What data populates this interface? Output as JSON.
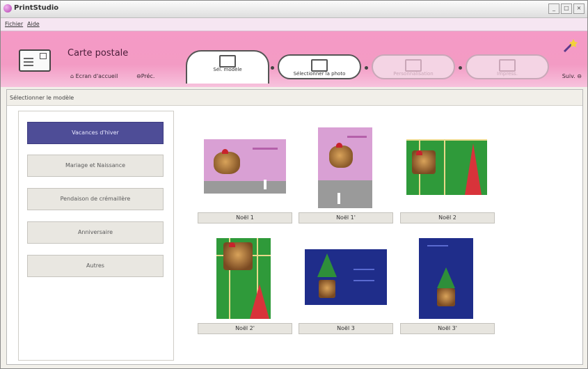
{
  "window": {
    "title": "PrintStudio",
    "controls": [
      "_",
      "□",
      "×"
    ]
  },
  "menu": {
    "items": [
      "Fichier",
      "Aide"
    ]
  },
  "header": {
    "title": "Carte postale",
    "home_label": "Ecran d'accueil",
    "prev_label": "Préc.",
    "next_label": "Suiv.",
    "steps": [
      {
        "label": "Sél. modèle",
        "state": "active",
        "icon": "template-icon"
      },
      {
        "label": "Sélectionner la photo",
        "state": "enabled",
        "icon": "photo-icon"
      },
      {
        "label": "Personnalisation",
        "state": "disabled",
        "icon": "customize-icon"
      },
      {
        "label": "Impress.",
        "state": "disabled",
        "icon": "printer-icon"
      }
    ]
  },
  "content": {
    "header_label": "Sélectionner le modèle",
    "categories": [
      {
        "label": "Vacances d'hiver",
        "selected": true
      },
      {
        "label": "Mariage et Naissance",
        "selected": false
      },
      {
        "label": "Pendaison de crémaillère",
        "selected": false
      },
      {
        "label": "Anniversaire",
        "selected": false
      },
      {
        "label": "Autres",
        "selected": false
      }
    ],
    "templates": [
      {
        "label": "Noël 1",
        "style": "pink-landscape"
      },
      {
        "label": "Noël 1'",
        "style": "pink-portrait"
      },
      {
        "label": "Noël 2",
        "style": "green-landscape"
      },
      {
        "label": "Noël 2'",
        "style": "green-portrait"
      },
      {
        "label": "Noël 3",
        "style": "blue-landscape"
      },
      {
        "label": "Noël 3'",
        "style": "blue-portrait"
      }
    ]
  },
  "colors": {
    "header_pink": "#f59ac6",
    "selected_category": "#4e4d97",
    "card_pink": "#d9a0d4",
    "card_green": "#2f9a3a",
    "card_blue": "#1f2d8a",
    "tree_red": "#d8333a"
  }
}
